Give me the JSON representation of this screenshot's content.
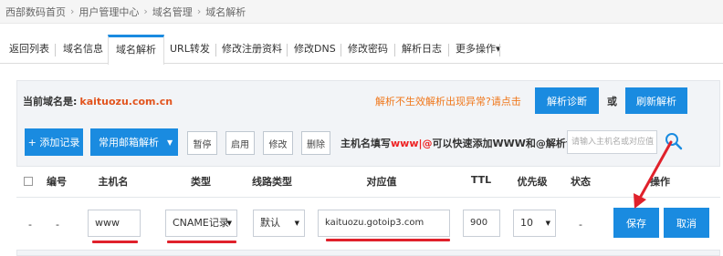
{
  "breadcrumb": [
    "西部数码首页",
    "用户管理中心",
    "域名管理",
    "域名解析"
  ],
  "tabs": [
    "返回列表",
    "域名信息",
    "域名解析",
    "URL转发",
    "修改注册资料",
    "修改DNS",
    "修改密码",
    "解析日志",
    "更多操作▾"
  ],
  "info": {
    "domain_label": "当前域名是:",
    "domain_value": "kaituozu.com.cn",
    "notice": "解析不生效解析出现异常?请点击",
    "diagnose_button": "解析诊断",
    "or_text": "或",
    "refresh_button": "刷新解析"
  },
  "toolbar": {
    "add_record": "+ 添加记录",
    "mail_resolve": "常用邮箱解析",
    "pause": "暂停",
    "enable": "启用",
    "modify": "修改",
    "delete": "删除",
    "hint_prefix": "主机名填写",
    "hint_highlight": "www|@",
    "hint_suffix": "可以快速添加WWW和@解析记录",
    "search_placeholder": "请输入主机名或对应值"
  },
  "table": {
    "headers": [
      "编号",
      "主机名",
      "类型",
      "线路类型",
      "对应值",
      "TTL",
      "优先级",
      "状态",
      "操作"
    ],
    "row": {
      "check": "-",
      "number": "-",
      "host": "www",
      "type": "CNAME记录",
      "line": "默认",
      "value": "kaituozu.gotoip3.com",
      "ttl": "900",
      "priority": "10",
      "status": "-",
      "save": "保存",
      "cancel": "取消"
    }
  },
  "colors": {
    "accent": "#1a8be0",
    "domain": "#e2541e",
    "notice": "#f0771b",
    "annotation": "#e0212b"
  }
}
